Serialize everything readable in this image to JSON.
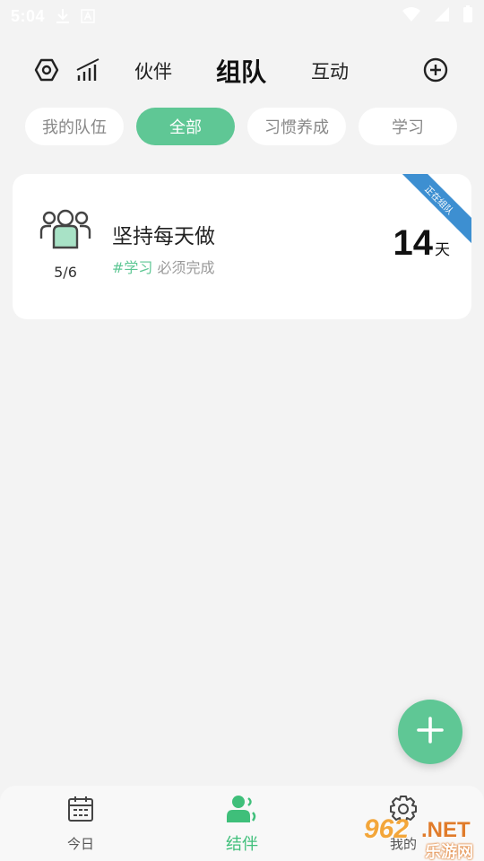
{
  "status_bar": {
    "time": "5:04"
  },
  "top_nav": {
    "tabs": [
      {
        "label": "伙伴",
        "active": false
      },
      {
        "label": "组队",
        "active": true
      },
      {
        "label": "互动",
        "active": false
      }
    ]
  },
  "filters": {
    "chips": [
      {
        "label": "我的队伍",
        "active": false
      },
      {
        "label": "全部",
        "active": true
      },
      {
        "label": "习惯养成",
        "active": false
      },
      {
        "label": "学习",
        "active": false
      }
    ]
  },
  "teams": [
    {
      "name": "坚持每天做",
      "member_count": "5/6",
      "tag": "#学习",
      "requirement": "必须完成",
      "days": "14",
      "days_unit": "天",
      "ribbon": "正在组队"
    }
  ],
  "bottom_nav": {
    "items": [
      {
        "label": "今日",
        "icon": "calendar-icon",
        "active": false
      },
      {
        "label": "结伴",
        "icon": "partner-icon",
        "active": true
      },
      {
        "label": "我的",
        "icon": "gear-icon",
        "active": false
      }
    ]
  },
  "watermark": {
    "number": "962",
    "domain": ".NET",
    "site": "乐游网"
  },
  "colors": {
    "accent": "#5fc795",
    "ribbon": "#3d8fd1",
    "background": "#f3f3f3"
  }
}
